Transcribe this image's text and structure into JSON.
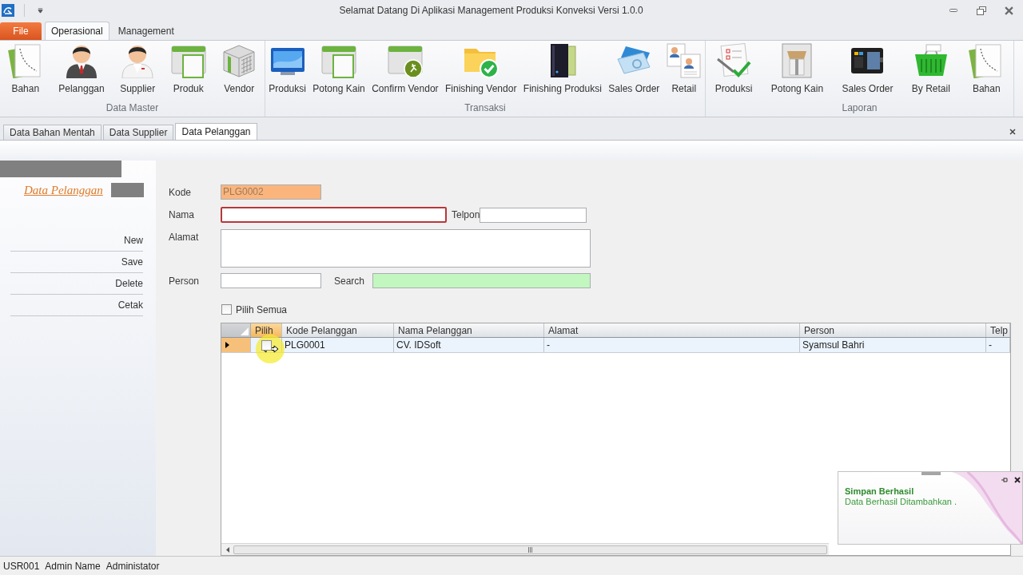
{
  "window": {
    "title": "Selamat Datang Di Aplikasi Management Produksi Konveksi Versi 1.0.0"
  },
  "ribbon": {
    "tabs": [
      {
        "label": "File",
        "kind": "menu",
        "selected": false
      },
      {
        "label": "Operasional",
        "kind": "tab",
        "selected": true
      },
      {
        "label": "Management",
        "kind": "tab",
        "selected": false
      }
    ],
    "groups": [
      {
        "label": "Data Master",
        "buttons": [
          "Bahan",
          "Pelanggan",
          "Supplier",
          "Produk",
          "Vendor"
        ]
      },
      {
        "label": "Transaksi",
        "buttons": [
          "Produksi",
          "Potong Kain",
          "Confirm Vendor",
          "Finishing Vendor",
          "Finishing Produksi",
          "Sales Order",
          "Retail"
        ]
      },
      {
        "label": "Laporan",
        "buttons": [
          "Produksi",
          "Potong Kain",
          "Sales Order",
          "By Retail",
          "Bahan"
        ]
      }
    ]
  },
  "document_tabs": [
    {
      "label": "Data Bahan Mentah",
      "selected": false
    },
    {
      "label": "Data Supplier",
      "selected": false
    },
    {
      "label": "Data Pelanggan",
      "selected": true
    }
  ],
  "sidebar": {
    "title": "Data Pelanggan",
    "items": [
      "New",
      "Save",
      "Delete",
      "Cetak"
    ]
  },
  "form": {
    "rows": [
      {
        "fields": [
          {
            "label": "Kode",
            "kind": "readonly",
            "value": "PLG0002",
            "focused": false
          }
        ]
      },
      {
        "fields": [
          {
            "label": "Nama",
            "kind": "text",
            "focused": true
          },
          {
            "label": "Telpon",
            "kind": "text",
            "focused": false
          }
        ]
      },
      {
        "fields": [
          {
            "label": "Alamat",
            "kind": "memo",
            "focused": false
          }
        ]
      },
      {
        "fields": [
          {
            "label": "Person",
            "kind": "text",
            "focused": false
          },
          {
            "label": "Search",
            "kind": "search",
            "focused": false
          }
        ]
      }
    ],
    "select_all": {
      "label": "Pilih Semua",
      "checked": false
    }
  },
  "grid": {
    "check_column": {
      "label": "Pilih",
      "highlighted": true
    },
    "columns": [
      {
        "label": "Kode Pelanggan",
        "highlighted": false
      },
      {
        "label": "Nama Pelanggan",
        "highlighted": false
      },
      {
        "label": "Alamat",
        "highlighted": false
      },
      {
        "label": "Person",
        "highlighted": false
      },
      {
        "label": "Telp",
        "highlighted": false
      }
    ],
    "rows": [
      {
        "selected": true,
        "checked": false,
        "cells": [
          "PLG0001",
          "CV. IDSoft",
          "-",
          "Syamsul Bahri",
          "-"
        ]
      }
    ]
  },
  "notification": {
    "title": "Simpan Berhasil",
    "message": "Data Berhasil Ditambahkan ."
  },
  "status_bar": [
    "USR001",
    "Admin Name",
    "Administator"
  ]
}
